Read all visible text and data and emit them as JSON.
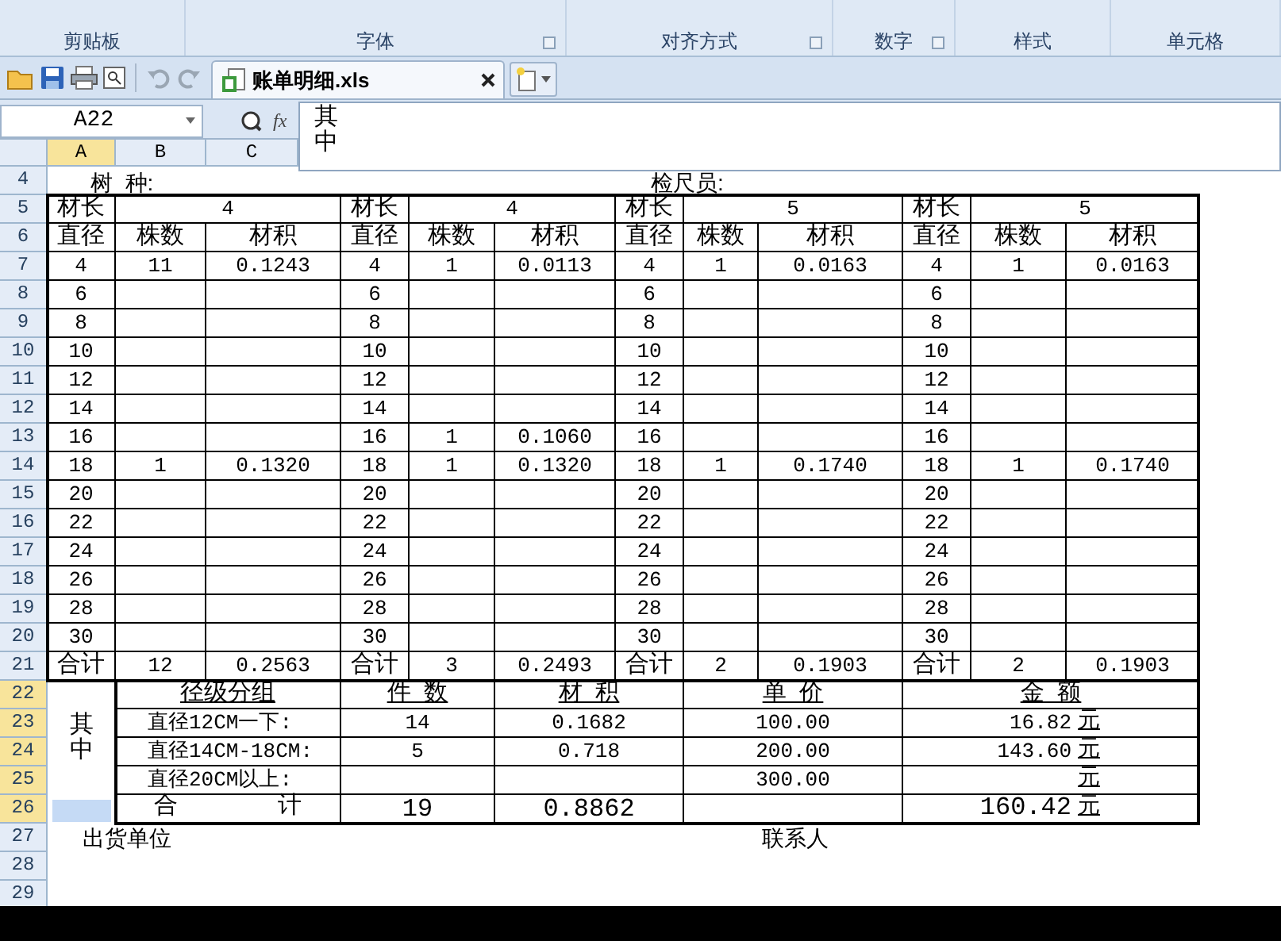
{
  "ribbon_groups": [
    {
      "label": "剪贴板",
      "launcher": false
    },
    {
      "label": "字体",
      "launcher": true
    },
    {
      "label": "对齐方式",
      "launcher": true
    },
    {
      "label": "数字",
      "launcher": true
    },
    {
      "label": "样式",
      "launcher": false
    },
    {
      "label": "单元格",
      "launcher": false
    }
  ],
  "document_tab": {
    "title": "账单明细.xls",
    "selected": true
  },
  "name_box": "A22",
  "fx_label": "fx",
  "formula_lines": [
    "其",
    "中"
  ],
  "column_headers": [
    {
      "label": "A",
      "selected": true
    },
    {
      "label": "B",
      "selected": false
    },
    {
      "label": "C",
      "selected": false
    }
  ],
  "row_numbers": [
    {
      "label": "4",
      "selected": false
    },
    {
      "label": "5",
      "selected": false
    },
    {
      "label": "6",
      "selected": false
    },
    {
      "label": "7",
      "selected": false
    },
    {
      "label": "8",
      "selected": false
    },
    {
      "label": "9",
      "selected": false
    },
    {
      "label": "10",
      "selected": false
    },
    {
      "label": "11",
      "selected": false
    },
    {
      "label": "12",
      "selected": false
    },
    {
      "label": "13",
      "selected": false
    },
    {
      "label": "14",
      "selected": false
    },
    {
      "label": "15",
      "selected": false
    },
    {
      "label": "16",
      "selected": false
    },
    {
      "label": "17",
      "selected": false
    },
    {
      "label": "18",
      "selected": false
    },
    {
      "label": "19",
      "selected": false
    },
    {
      "label": "20",
      "selected": false
    },
    {
      "label": "21",
      "selected": false
    },
    {
      "label": "22",
      "selected": true
    },
    {
      "label": "23",
      "selected": true
    },
    {
      "label": "24",
      "selected": true
    },
    {
      "label": "25",
      "selected": true
    },
    {
      "label": "26",
      "selected": true
    },
    {
      "label": "27",
      "selected": false
    },
    {
      "label": "28",
      "selected": false
    },
    {
      "label": "29",
      "selected": false
    }
  ],
  "species_label": "树  种:",
  "inspector_label": "检尺员:",
  "blocks": [
    {
      "length_label": "材长",
      "length": "4",
      "headers": [
        "直径",
        "株数",
        "材积"
      ],
      "rows": [
        {
          "diameter": "4",
          "count": "11",
          "volume": "0.1243"
        },
        {
          "diameter": "6"
        },
        {
          "diameter": "8"
        },
        {
          "diameter": "10"
        },
        {
          "diameter": "12"
        },
        {
          "diameter": "14"
        },
        {
          "diameter": "16"
        },
        {
          "diameter": "18",
          "count": "1",
          "volume": "0.1320"
        },
        {
          "diameter": "20"
        },
        {
          "diameter": "22"
        },
        {
          "diameter": "24"
        },
        {
          "diameter": "26"
        },
        {
          "diameter": "28"
        },
        {
          "diameter": "30"
        }
      ],
      "total": {
        "label": "合计",
        "count": "12",
        "volume": "0.2563"
      }
    },
    {
      "length_label": "材长",
      "length": "4",
      "headers": [
        "直径",
        "株数",
        "材积"
      ],
      "rows": [
        {
          "diameter": "4",
          "count": "1",
          "volume": "0.0113"
        },
        {
          "diameter": "6"
        },
        {
          "diameter": "8"
        },
        {
          "diameter": "10"
        },
        {
          "diameter": "12"
        },
        {
          "diameter": "14"
        },
        {
          "diameter": "16",
          "count": "1",
          "volume": "0.1060"
        },
        {
          "diameter": "18",
          "count": "1",
          "volume": "0.1320"
        },
        {
          "diameter": "20"
        },
        {
          "diameter": "22"
        },
        {
          "diameter": "24"
        },
        {
          "diameter": "26"
        },
        {
          "diameter": "28"
        },
        {
          "diameter": "30"
        }
      ],
      "total": {
        "label": "合计",
        "count": "3",
        "volume": "0.2493"
      }
    },
    {
      "length_label": "材长",
      "length": "5",
      "headers": [
        "直径",
        "株数",
        "材积"
      ],
      "rows": [
        {
          "diameter": "4",
          "count": "1",
          "volume": "0.0163"
        },
        {
          "diameter": "6"
        },
        {
          "diameter": "8"
        },
        {
          "diameter": "10"
        },
        {
          "diameter": "12"
        },
        {
          "diameter": "14"
        },
        {
          "diameter": "16"
        },
        {
          "diameter": "18",
          "count": "1",
          "volume": "0.1740"
        },
        {
          "diameter": "20"
        },
        {
          "diameter": "22"
        },
        {
          "diameter": "24"
        },
        {
          "diameter": "26"
        },
        {
          "diameter": "28"
        },
        {
          "diameter": "30"
        }
      ],
      "total": {
        "label": "合计",
        "count": "2",
        "volume": "0.1903"
      }
    },
    {
      "length_label": "材长",
      "length": "5",
      "headers": [
        "直径",
        "株数",
        "材积"
      ],
      "rows": [
        {
          "diameter": "4",
          "count": "1",
          "volume": "0.0163"
        },
        {
          "diameter": "6"
        },
        {
          "diameter": "8"
        },
        {
          "diameter": "10"
        },
        {
          "diameter": "12"
        },
        {
          "diameter": "14"
        },
        {
          "diameter": "16"
        },
        {
          "diameter": "18",
          "count": "1",
          "volume": "0.1740"
        },
        {
          "diameter": "20"
        },
        {
          "diameter": "22"
        },
        {
          "diameter": "24"
        },
        {
          "diameter": "26"
        },
        {
          "diameter": "28"
        },
        {
          "diameter": "30"
        }
      ],
      "total": {
        "label": "合计",
        "count": "2",
        "volume": "0.1903"
      }
    }
  ],
  "summary": {
    "side_label": "其中",
    "total_side_selected": true,
    "columns": [
      "径级分组",
      "件  数",
      "材  积",
      "单  价",
      "金  额"
    ],
    "rows": [
      {
        "group": "直径12CM一下:",
        "count": "14",
        "volume": "0.1682",
        "price": "100.00",
        "amount": "16.82",
        "unit": "元"
      },
      {
        "group": "直径14CM-18CM:",
        "count": "5",
        "volume": "0.718",
        "price": "200.00",
        "amount": "143.60",
        "unit": "元"
      },
      {
        "group": "直径20CM以上:",
        "price": "300.00",
        "unit": "元"
      }
    ],
    "total": {
      "label": "合       计",
      "count": "19",
      "volume": "0.8862",
      "amount": "160.42",
      "unit": "元"
    }
  },
  "footer": {
    "shipper_label": "出货单位",
    "contact_label": "联系人"
  }
}
